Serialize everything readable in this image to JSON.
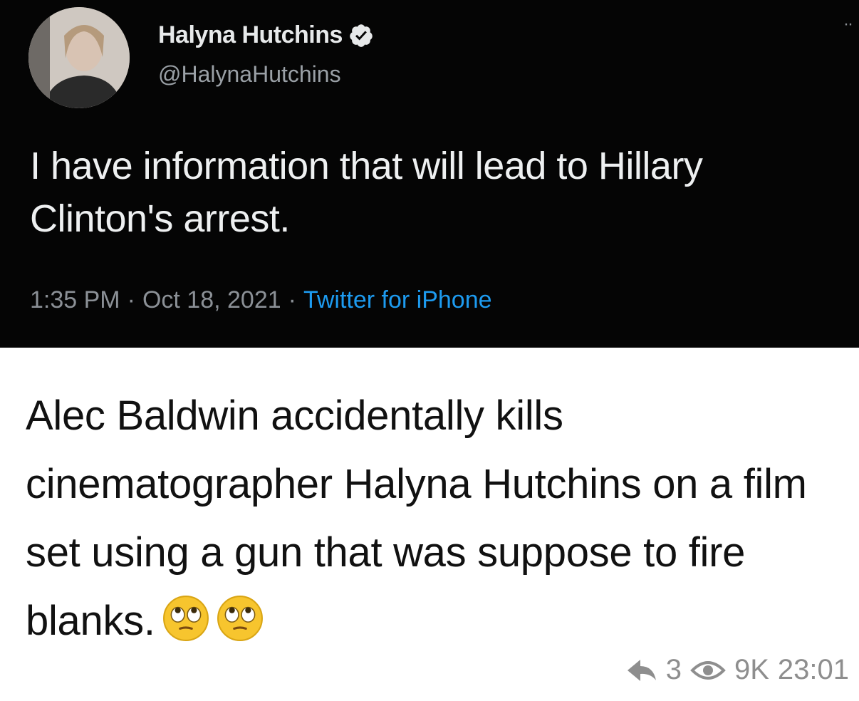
{
  "tweet": {
    "display_name": "Halyna Hutchins",
    "handle": "@HalynaHutchins",
    "text": "I have information that will lead to Hillary Clinton's arrest.",
    "time": "1:35 PM",
    "date": "Oct 18, 2021",
    "source": "Twitter for iPhone",
    "separator": "·",
    "more_icon": "more-dots-icon",
    "verified_icon": "verified-badge-icon",
    "colors": {
      "background": "#050505",
      "text": "#e7e9ea",
      "muted": "#8b9096",
      "link": "#1d9bf0"
    }
  },
  "post": {
    "caption": "Alec Baldwin accidentally kills cinematographer Halyna Hutchins on a film set using a gun that was suppose to fire blanks.",
    "emoji_icons": [
      "face-with-rolling-eyes-icon",
      "face-with-rolling-eyes-icon"
    ],
    "replies": "3",
    "views": "9K",
    "time": "23:01",
    "reply_icon": "reply-arrow-icon",
    "views_icon": "eye-icon"
  }
}
